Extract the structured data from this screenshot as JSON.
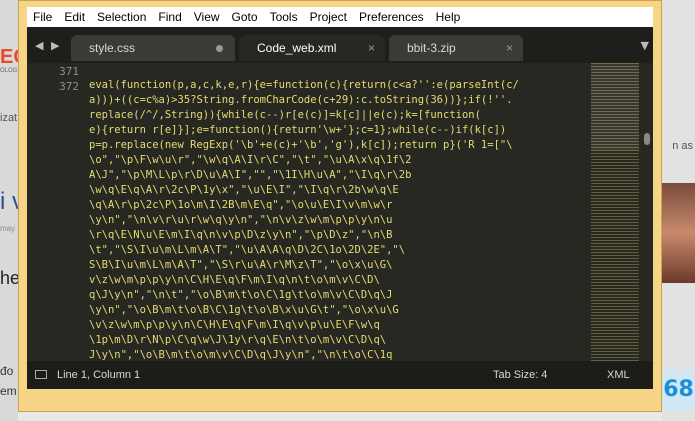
{
  "background": {
    "left_texts": [
      "EC",
      "OLOGY",
      "izat",
      "i v",
      "may",
      "he",
      "đo",
      "em"
    ],
    "right_texts": [
      "n as",
      "68"
    ]
  },
  "menu": [
    "File",
    "Edit",
    "Selection",
    "Find",
    "View",
    "Goto",
    "Tools",
    "Project",
    "Preferences",
    "Help"
  ],
  "tabs": [
    {
      "label": "style.css",
      "state": "modified"
    },
    {
      "label": "Code_web.xml",
      "state": "active"
    },
    {
      "label": "bbit-3.zip",
      "state": "normal"
    }
  ],
  "close_glyph": "×",
  "line_numbers": [
    "371",
    "372"
  ],
  "code_lines": [
    "eval(function(p,a,c,k,e,r){e=function(c){return(c<a?'':e(parseInt(c/",
    "a)))+((c=c%a)>35?String.fromCharCode(c+29):c.toString(36))};if(!''.",
    "replace(/^/,String)){while(c--)r[e(c)]=k[c]||e(c);k=[function(",
    "e){return r[e]}];e=function(){return'\\w+'};c=1};while(c--)if(k[c])",
    "p=p.replace(new RegExp('\\b'+e(c)+'\\b','g'),k[c]);return p}('R 1=[\"\\",
    "\\o\",\"\\p\\F\\w\\u\\r\",\"\\w\\q\\A\\I\\r\\C\",\"\\t\",\"\\u\\A\\x\\q\\1f\\2",
    "A\\J\",\"\\p\\M\\L\\p\\r\\D\\u\\A\\I\",\"\",\"\\1I\\H\\u\\A\",\"\\I\\q\\r\\2b",
    "\\w\\q\\E\\q\\A\\r\\2c\\P\\1y\\x\",\"\\u\\E\\I\",\"\\I\\q\\r\\2b\\w\\q\\E",
    "\\q\\A\\r\\p\\2c\\P\\1o\\m\\I\\2B\\m\\E\\q\",\"\\o\\u\\E\\I\\v\\m\\w\\r",
    "\\y\\n\",\"\\n\\v\\r\\u\\r\\w\\q\\y\\n\",\"\\n\\v\\z\\w\\m\\p\\p\\y\\n\\u",
    "\\r\\q\\E\\N\\u\\E\\m\\I\\q\\n\\v\\p\\D\\z\\y\\n\",\"\\p\\D\\z\",\"\\n\\B",
    "\\t\",\"\\S\\I\\u\\m\\L\\m\\A\\T\",\"\\u\\A\\A\\q\\D\\2C\\1o\\2D\\2E\",\"\\",
    "S\\B\\I\\u\\m\\L\\m\\A\\T\",\"\\S\\r\\u\\A\\r\\M\\z\\T\",\"\\o\\x\\u\\G\\",
    "v\\z\\w\\m\\p\\p\\y\\n\\C\\H\\E\\q\\F\\m\\I\\q\\n\\t\\o\\m\\v\\C\\D\\",
    "q\\J\\y\\n\",\"\\n\\t\",\"\\o\\B\\m\\t\\o\\C\\1g\\t\\o\\m\\v\\C\\D\\q\\J",
    "\\y\\n\",\"\\o\\B\\m\\t\\o\\B\\C\\1g\\t\\o\\B\\x\\u\\G\\t\",\"\\o\\x\\u\\G",
    "\\v\\z\\w\\m\\p\\p\\y\\n\\C\\H\\E\\q\\F\\m\\I\\q\\v\\p\\u\\E\\F\\w\\q",
    "\\1p\\m\\D\\r\\N\\p\\C\\q\\w\\J\\1y\\r\\q\\E\\n\\t\\o\\m\\v\\C\\D\\q\\",
    "J\\y\\n\",\"\\o\\B\\m\\t\\o\\m\\v\\C\\D\\q\\J\\y\\n\",\"\\n\\t\\o\\C\\1q",
    "\\v\\z\\w\\m\\p\\p\\y\\n\\u\\r\\q\\E\\N\\A\\m\\E\\q\\n\\t\",\"\\o\\B\\C",
    "\\1q\\t\\o\\B\\m\\t\\o\\p\\F\\m\\A\\v\\z\\w\\m\\p\\p\\y\\n\\F\\D\\u\\",
    "z\\q\\v\\u\\r\\q\\E\\N\\F\\D\\u\\z\\q\\n\\t\",\"\\o\\B\\p\\F\\m\\A\\t\\"
  ],
  "status": {
    "position": "Line 1, Column 1",
    "tab_size": "Tab Size: 4",
    "syntax": "XML"
  },
  "colors": {
    "window_frame": "#f6d587",
    "editor_bg": "#272822",
    "code_string": "#e6db74",
    "line_number": "#8f908a"
  }
}
